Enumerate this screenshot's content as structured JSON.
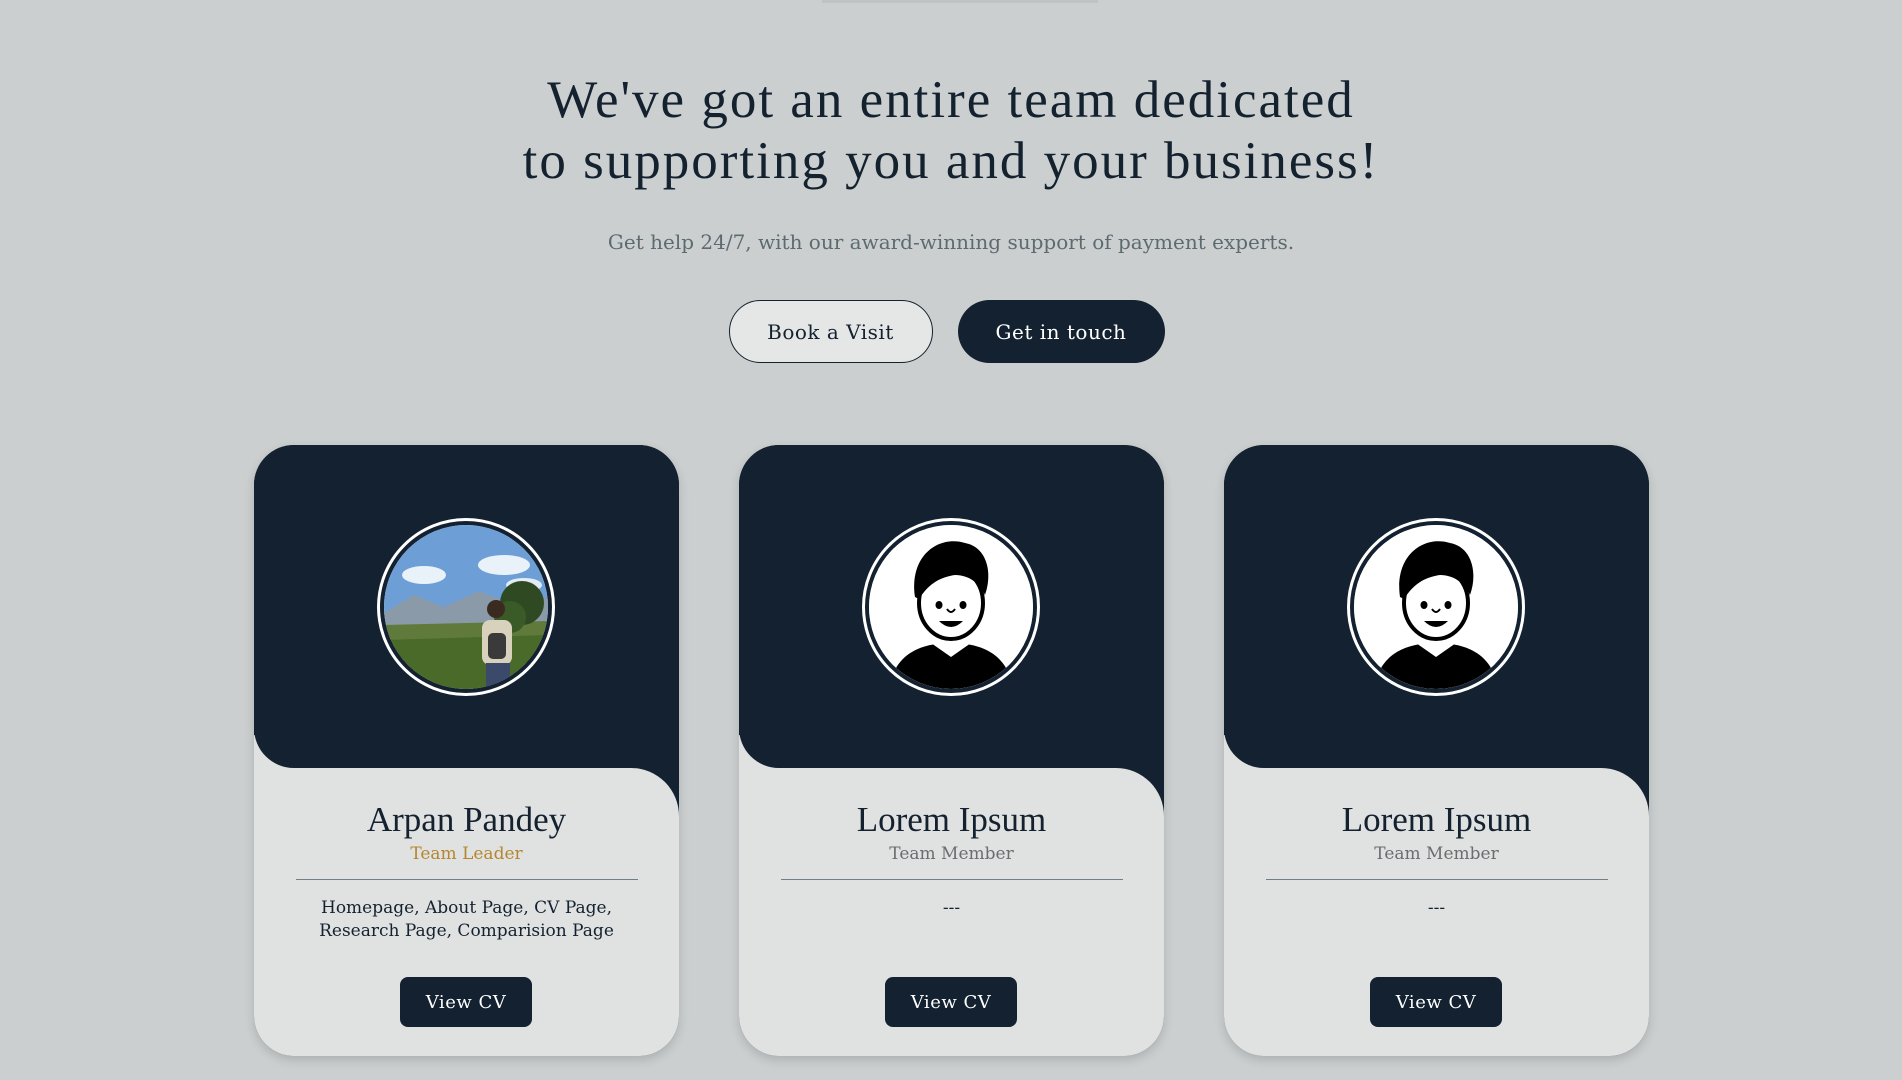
{
  "hero": {
    "title_line1": "We've got an entire team dedicated",
    "title_line2": "to supporting you and your business!",
    "subtitle": "Get help 24/7, with our award-winning support of payment experts."
  },
  "buttons": {
    "book_visit": "Book a Visit",
    "get_in_touch": "Get in touch"
  },
  "colors": {
    "background": "#cbcfcf",
    "navy": "#132130",
    "card_light": "#e0e2e2",
    "lead_role": "#b5862d"
  },
  "team": [
    {
      "name": "Arpan Pandey",
      "role": "Team Leader",
      "description": "Homepage, About Page, CV Page, Research Page, Comparision Page",
      "avatar": "photo-hiker",
      "cv_label": "View CV"
    },
    {
      "name": "Lorem Ipsum",
      "role": "Team Member",
      "description": "---",
      "avatar": "person-illustration-icon",
      "cv_label": "View CV"
    },
    {
      "name": "Lorem Ipsum",
      "role": "Team Member",
      "description": "---",
      "avatar": "person-illustration-icon",
      "cv_label": "View CV"
    }
  ]
}
